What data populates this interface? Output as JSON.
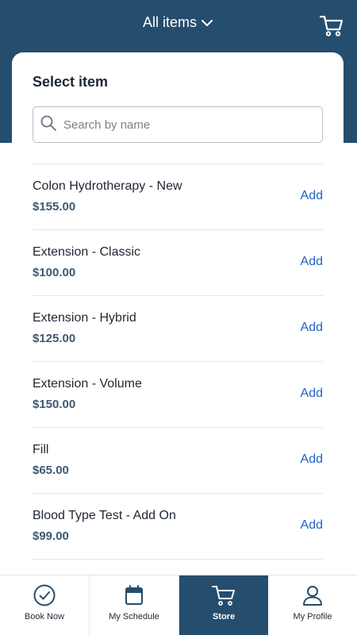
{
  "header": {
    "filter_label": "All items",
    "colors": {
      "header_bg": "#254d6e",
      "link": "#1f63c6",
      "price": "#3f5973"
    },
    "cart_icon": "cart-icon",
    "chevron_icon": "chevron-down-icon"
  },
  "card": {
    "title": "Select item",
    "search": {
      "placeholder": "Search by name",
      "value": ""
    }
  },
  "items": [
    {
      "name": "Colon Hydrotherapy - New",
      "price": "$155.00",
      "action": "Add"
    },
    {
      "name": "Extension - Classic",
      "price": "$100.00",
      "action": "Add"
    },
    {
      "name": "Extension - Hybrid",
      "price": "$125.00",
      "action": "Add"
    },
    {
      "name": "Extension - Volume",
      "price": "$150.00",
      "action": "Add"
    },
    {
      "name": "Fill",
      "price": "$65.00",
      "action": "Add"
    },
    {
      "name": "Blood Type Test - Add On",
      "price": "$99.00",
      "action": "Add"
    }
  ],
  "nav": {
    "active": "Store",
    "tabs": [
      {
        "label": "Book Now",
        "icon": "check-circle-icon"
      },
      {
        "label": "My Schedule",
        "icon": "calendar-icon"
      },
      {
        "label": "Store",
        "icon": "cart-icon"
      },
      {
        "label": "My Profile",
        "icon": "user-icon"
      }
    ]
  }
}
